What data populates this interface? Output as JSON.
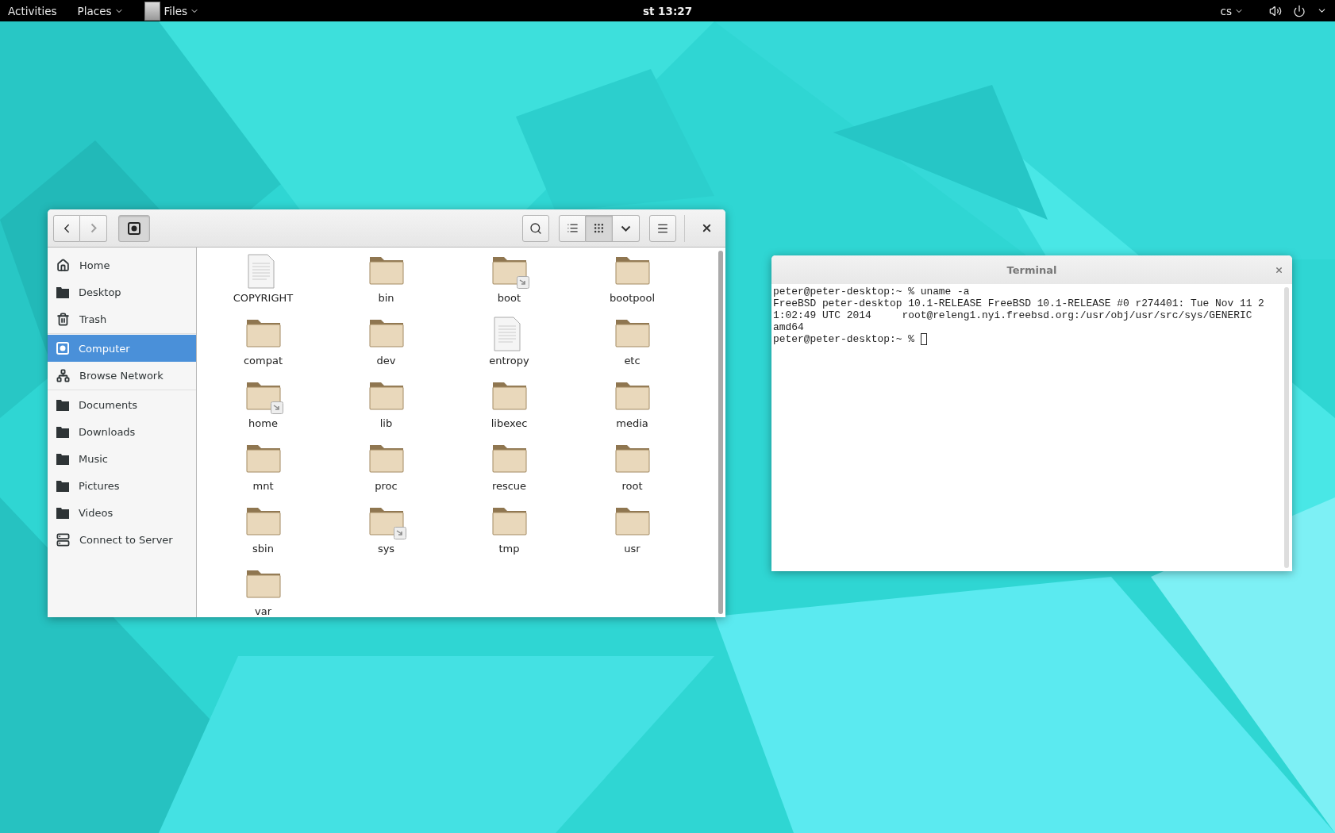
{
  "top_bar": {
    "activities": "Activities",
    "menus": [
      {
        "label": "Places",
        "app_icon": false
      },
      {
        "label": "Files",
        "app_icon": true
      }
    ],
    "clock": "st 13:27",
    "input_source": "cs"
  },
  "files_window": {
    "toolbar": {
      "back": {
        "disabled": false
      },
      "forward": {
        "disabled": true
      },
      "location_selected": true,
      "views": [
        {
          "kind": "list",
          "selected": false
        },
        {
          "kind": "grid",
          "selected": true
        }
      ]
    },
    "sidebar": {
      "sections": [
        {
          "items": [
            {
              "label": "Home",
              "kind": "home",
              "selected": false
            },
            {
              "label": "Desktop",
              "kind": "folder",
              "selected": false
            },
            {
              "label": "Trash",
              "kind": "trash",
              "selected": false
            }
          ]
        },
        {
          "items": [
            {
              "label": "Computer",
              "kind": "drive",
              "selected": true
            },
            {
              "label": "Browse Network",
              "kind": "network",
              "selected": false
            }
          ]
        },
        {
          "items": [
            {
              "label": "Documents",
              "kind": "folder",
              "selected": false
            },
            {
              "label": "Downloads",
              "kind": "folder",
              "selected": false
            },
            {
              "label": "Music",
              "kind": "folder",
              "selected": false
            },
            {
              "label": "Pictures",
              "kind": "folder",
              "selected": false
            },
            {
              "label": "Videos",
              "kind": "folder",
              "selected": false
            },
            {
              "label": "Connect to Server",
              "kind": "server",
              "selected": false
            }
          ]
        }
      ]
    },
    "files": [
      {
        "name": "COPYRIGHT",
        "kind": "document",
        "link": false
      },
      {
        "name": "bin",
        "kind": "folder",
        "link": false
      },
      {
        "name": "boot",
        "kind": "folder",
        "link": true
      },
      {
        "name": "bootpool",
        "kind": "folder",
        "link": false
      },
      {
        "name": "compat",
        "kind": "folder",
        "link": false
      },
      {
        "name": "dev",
        "kind": "folder",
        "link": false
      },
      {
        "name": "entropy",
        "kind": "document",
        "link": false
      },
      {
        "name": "etc",
        "kind": "folder",
        "link": false
      },
      {
        "name": "home",
        "kind": "folder",
        "link": true
      },
      {
        "name": "lib",
        "kind": "folder",
        "link": false
      },
      {
        "name": "libexec",
        "kind": "folder",
        "link": false
      },
      {
        "name": "media",
        "kind": "folder",
        "link": false
      },
      {
        "name": "mnt",
        "kind": "folder",
        "link": false
      },
      {
        "name": "proc",
        "kind": "folder",
        "link": false
      },
      {
        "name": "rescue",
        "kind": "folder",
        "link": false
      },
      {
        "name": "root",
        "kind": "folder",
        "link": false
      },
      {
        "name": "sbin",
        "kind": "folder",
        "link": false
      },
      {
        "name": "sys",
        "kind": "folder",
        "link": true
      },
      {
        "name": "tmp",
        "kind": "folder",
        "link": false
      },
      {
        "name": "usr",
        "kind": "folder",
        "link": false
      },
      {
        "name": "var",
        "kind": "folder",
        "link": false
      }
    ]
  },
  "terminal": {
    "title": "Terminal",
    "lines": [
      "peter@peter-desktop:~ % uname -a",
      "FreeBSD peter-desktop 10.1-RELEASE FreeBSD 10.1-RELEASE #0 r274401: Tue Nov 11 2",
      "1:02:49 UTC 2014     root@releng1.nyi.freebsd.org:/usr/obj/usr/src/sys/GENERIC",
      "amd64",
      "peter@peter-desktop:~ % "
    ],
    "cursor": true
  }
}
